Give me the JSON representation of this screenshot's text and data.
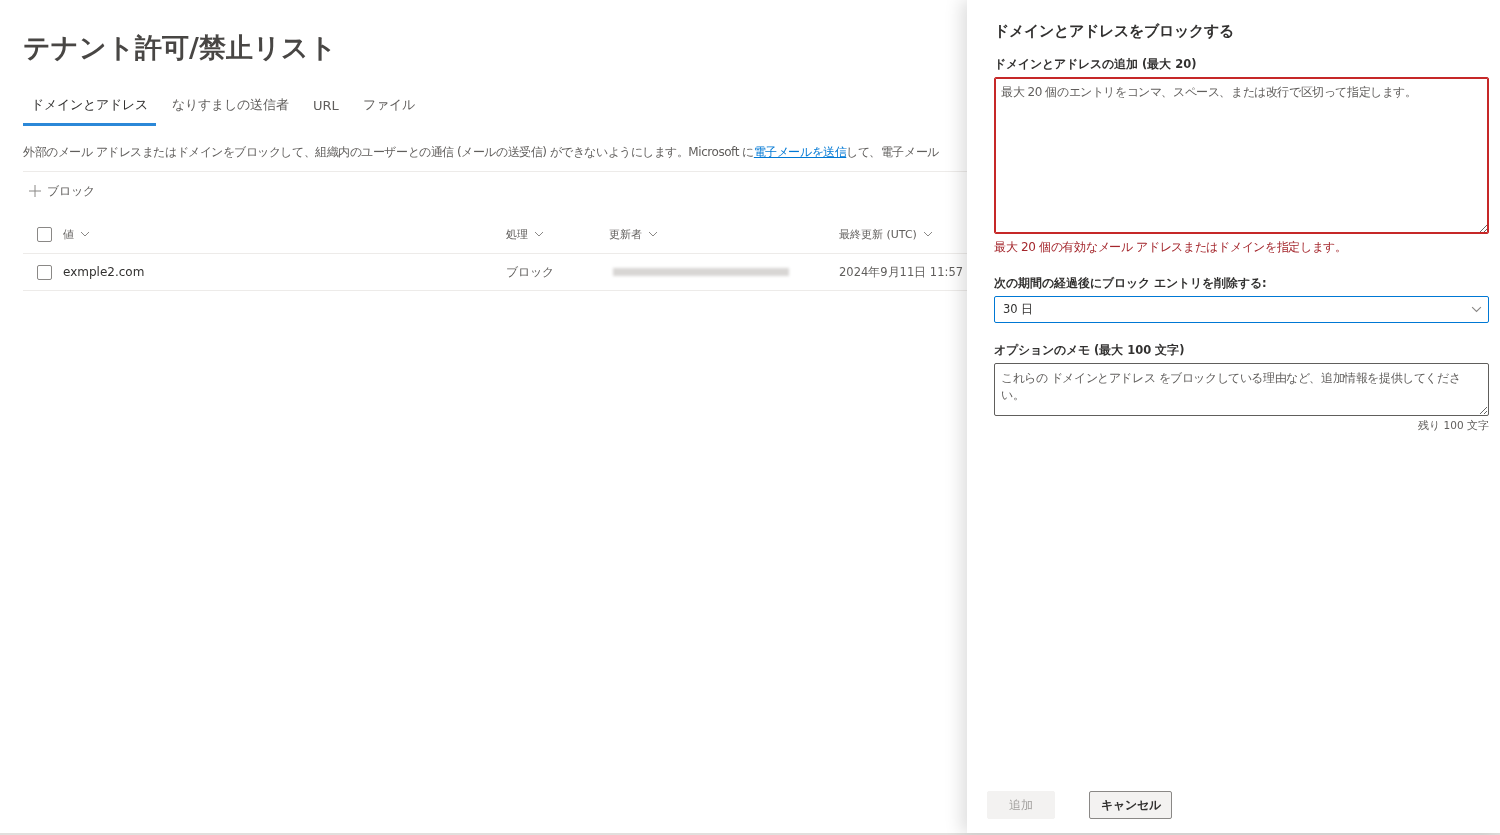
{
  "page": {
    "title": "テナント許可/禁止リスト"
  },
  "tabs": [
    {
      "label": "ドメインとアドレス",
      "selected": true
    },
    {
      "label": "なりすましの送信者",
      "selected": false
    },
    {
      "label": "URL",
      "selected": false
    },
    {
      "label": "ファイル",
      "selected": false
    }
  ],
  "description": {
    "before": "外部のメール アドレスまたはドメインをブロックして、組織内のユーザーとの通信 (メールの送受信) ができないようにします。Microsoft に",
    "link": "電子メールを送信",
    "after": "して、電子メール"
  },
  "toolbar": {
    "block_button": "ブロック"
  },
  "table": {
    "select_all_checked": false,
    "columns": [
      "値",
      "処理",
      "更新者",
      "最終更新 (UTC)"
    ],
    "rows": [
      {
        "checked": false,
        "value": "exmple2.com",
        "action": "ブロック",
        "updated_by_redacted": true,
        "updated": "2024年9月11日 11:57"
      }
    ]
  },
  "panel": {
    "title": "ドメインとアドレスをブロックする",
    "entries": {
      "label": "ドメインとアドレスの追加 (最大 20)",
      "placeholder": "最大 20 個のエントリをコンマ、スペース、または改行で区切って指定します。",
      "invalid": true,
      "error": "最大 20 個の有効なメール アドレスまたはドメインを指定します。"
    },
    "expiry": {
      "label": "次の期間の経過後にブロック エントリを削除する:",
      "value": "30 日",
      "focused": true
    },
    "note": {
      "label": "オプションのメモ (最大 100 文字)",
      "placeholder": "これらの ドメインとアドレス をブロックしている理由など、追加情報を提供してください。",
      "counter": "残り 100 文字"
    },
    "buttons": [
      {
        "label": "追加",
        "kind": "primary",
        "disabled": true
      },
      {
        "label": "キャンセル",
        "kind": "secondary",
        "disabled": false
      }
    ]
  }
}
